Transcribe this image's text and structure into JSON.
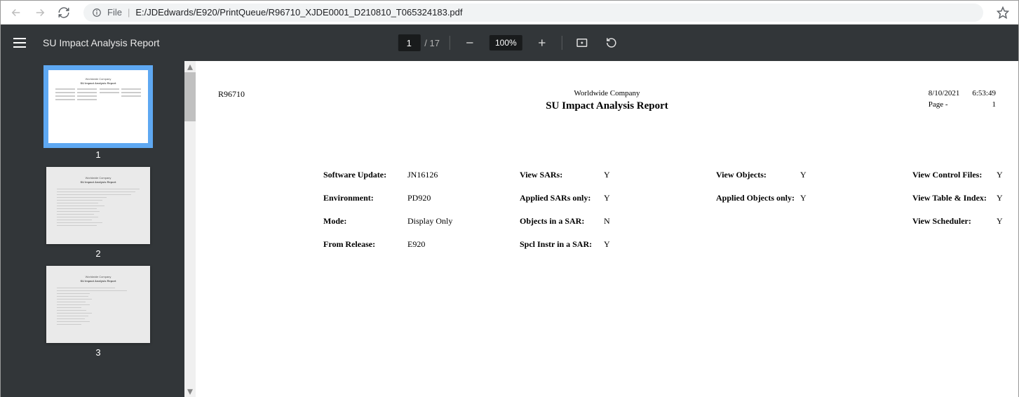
{
  "browser": {
    "file_label": "File",
    "url": "E:/JDEdwards/E920/PrintQueue/R96710_XJDE0001_D210810_T065324183.pdf"
  },
  "toolbar": {
    "title": "SU Impact Analysis Report",
    "page_current": "1",
    "page_total": "/ 17",
    "zoom": "100%"
  },
  "thumbs": {
    "p1": "1",
    "p2": "2",
    "p3": "3"
  },
  "doc": {
    "id": "R96710",
    "company": "Worldwide Company",
    "title": "SU Impact Analysis Report",
    "date": "8/10/2021",
    "time": "6:53:49",
    "page_label": "Page -",
    "page_num": "1",
    "params": {
      "c1": [
        {
          "l": "Software Update:",
          "v": "JN16126"
        },
        {
          "l": "Environment:",
          "v": "PD920"
        },
        {
          "l": "Mode:",
          "v": "Display Only"
        },
        {
          "l": "From Release:",
          "v": "E920"
        }
      ],
      "c2": [
        {
          "l": "View SARs:",
          "v": "Y"
        },
        {
          "l": "Applied SARs only:",
          "v": "Y"
        },
        {
          "l": "Objects in a SAR:",
          "v": "N"
        },
        {
          "l": "Spcl Instr in a SAR:",
          "v": "Y"
        }
      ],
      "c3": [
        {
          "l": "View Objects:",
          "v": "Y"
        },
        {
          "l": "Applied Objects only:",
          "v": "Y"
        }
      ],
      "c4": [
        {
          "l": "View Control Files:",
          "v": "Y"
        },
        {
          "l": "View Table & Index:",
          "v": "Y"
        },
        {
          "l": "View Scheduler:",
          "v": "Y"
        }
      ]
    }
  }
}
